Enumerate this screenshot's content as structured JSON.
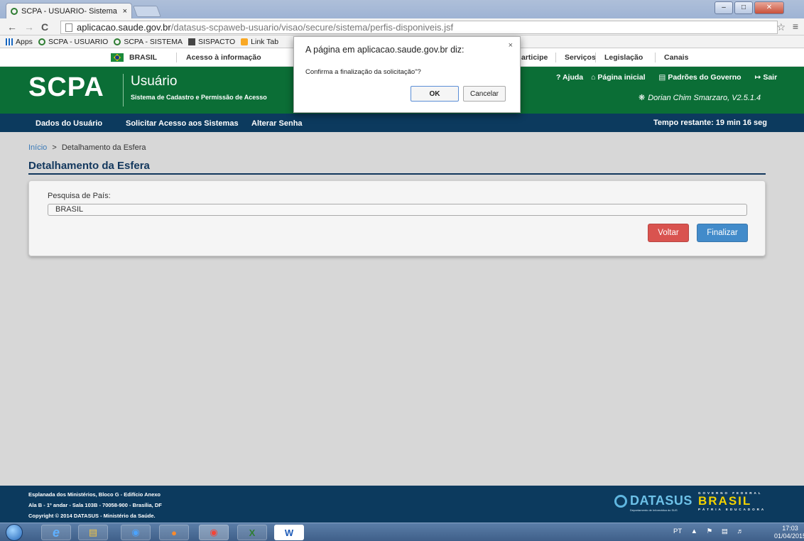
{
  "browser": {
    "tab_title": "SCPA - USUARIO- Sistema",
    "tab_close": "×",
    "back": "←",
    "forward": "→",
    "reload": "C",
    "address_host": "aplicacao.saude.gov.br",
    "address_path": "/datasus-scpaweb-usuario/visao/secure/sistema/perfis-disponiveis.jsf",
    "star": "☆",
    "menu": "≡",
    "window_min": "–",
    "window_max": "□",
    "window_close": "✕",
    "bookmarks": [
      "Apps",
      "SCPA - USUARIO",
      "SCPA - SISTEMA",
      "SISPACTO",
      "Link Tab"
    ]
  },
  "govbar": {
    "brasil": "BRASIL",
    "acesso": "Acesso à informação",
    "participe": "articipe",
    "servicos": "Serviços",
    "legislacao": "Legislação",
    "canais": "Canais"
  },
  "header": {
    "logo": "SCPA",
    "app_title": "Usuário",
    "app_subtitle": "Sistema de Cadastro e Permissão de Acesso",
    "help": "? Ajuda",
    "home": "Página inicial",
    "standards": "Padrões do Governo",
    "logout": "Sair",
    "user": "Dorian Chim Smarzaro, V2.5.1.4"
  },
  "navbar": {
    "items": [
      "Dados do Usuário",
      "Solicitar Acesso aos Sistemas",
      "Alterar Senha"
    ],
    "timer": "Tempo restante: 19 min 16 seg"
  },
  "content": {
    "breadcrumb_home": "Início",
    "breadcrumb_sep": ">",
    "breadcrumb_current": "Detalhamento da Esfera",
    "title": "Detalhamento da Esfera",
    "field_label": "Pesquisa de País:",
    "field_value": "BRASIL",
    "back_button": "Voltar",
    "finish_button": "Finalizar"
  },
  "dialog": {
    "title": "A página em aplicacao.saude.gov.br diz:",
    "message": "Confirma a finalização da solicitação\"?",
    "ok": "OK",
    "cancel": "Cancelar",
    "close": "×"
  },
  "footer": {
    "line1": "Esplanada dos Ministérios, Bloco G - Edifício Anexo",
    "line2": "Ala B - 1º andar - Sala 103B - 70058-900 - Brasília, DF",
    "line3": "Copyright © 2014 DATASUS - Ministério da Saúde.",
    "datasus": "DATASUS",
    "datasus_tag": "Departamento de Informática do SUS",
    "gov_federal": "GOVERNO FEDERAL",
    "brasil": "BRASIL",
    "patria": "PÁTRIA EDUCADORA"
  },
  "taskbar": {
    "lang": "PT",
    "time": "17:03",
    "date": "01/04/2015"
  }
}
